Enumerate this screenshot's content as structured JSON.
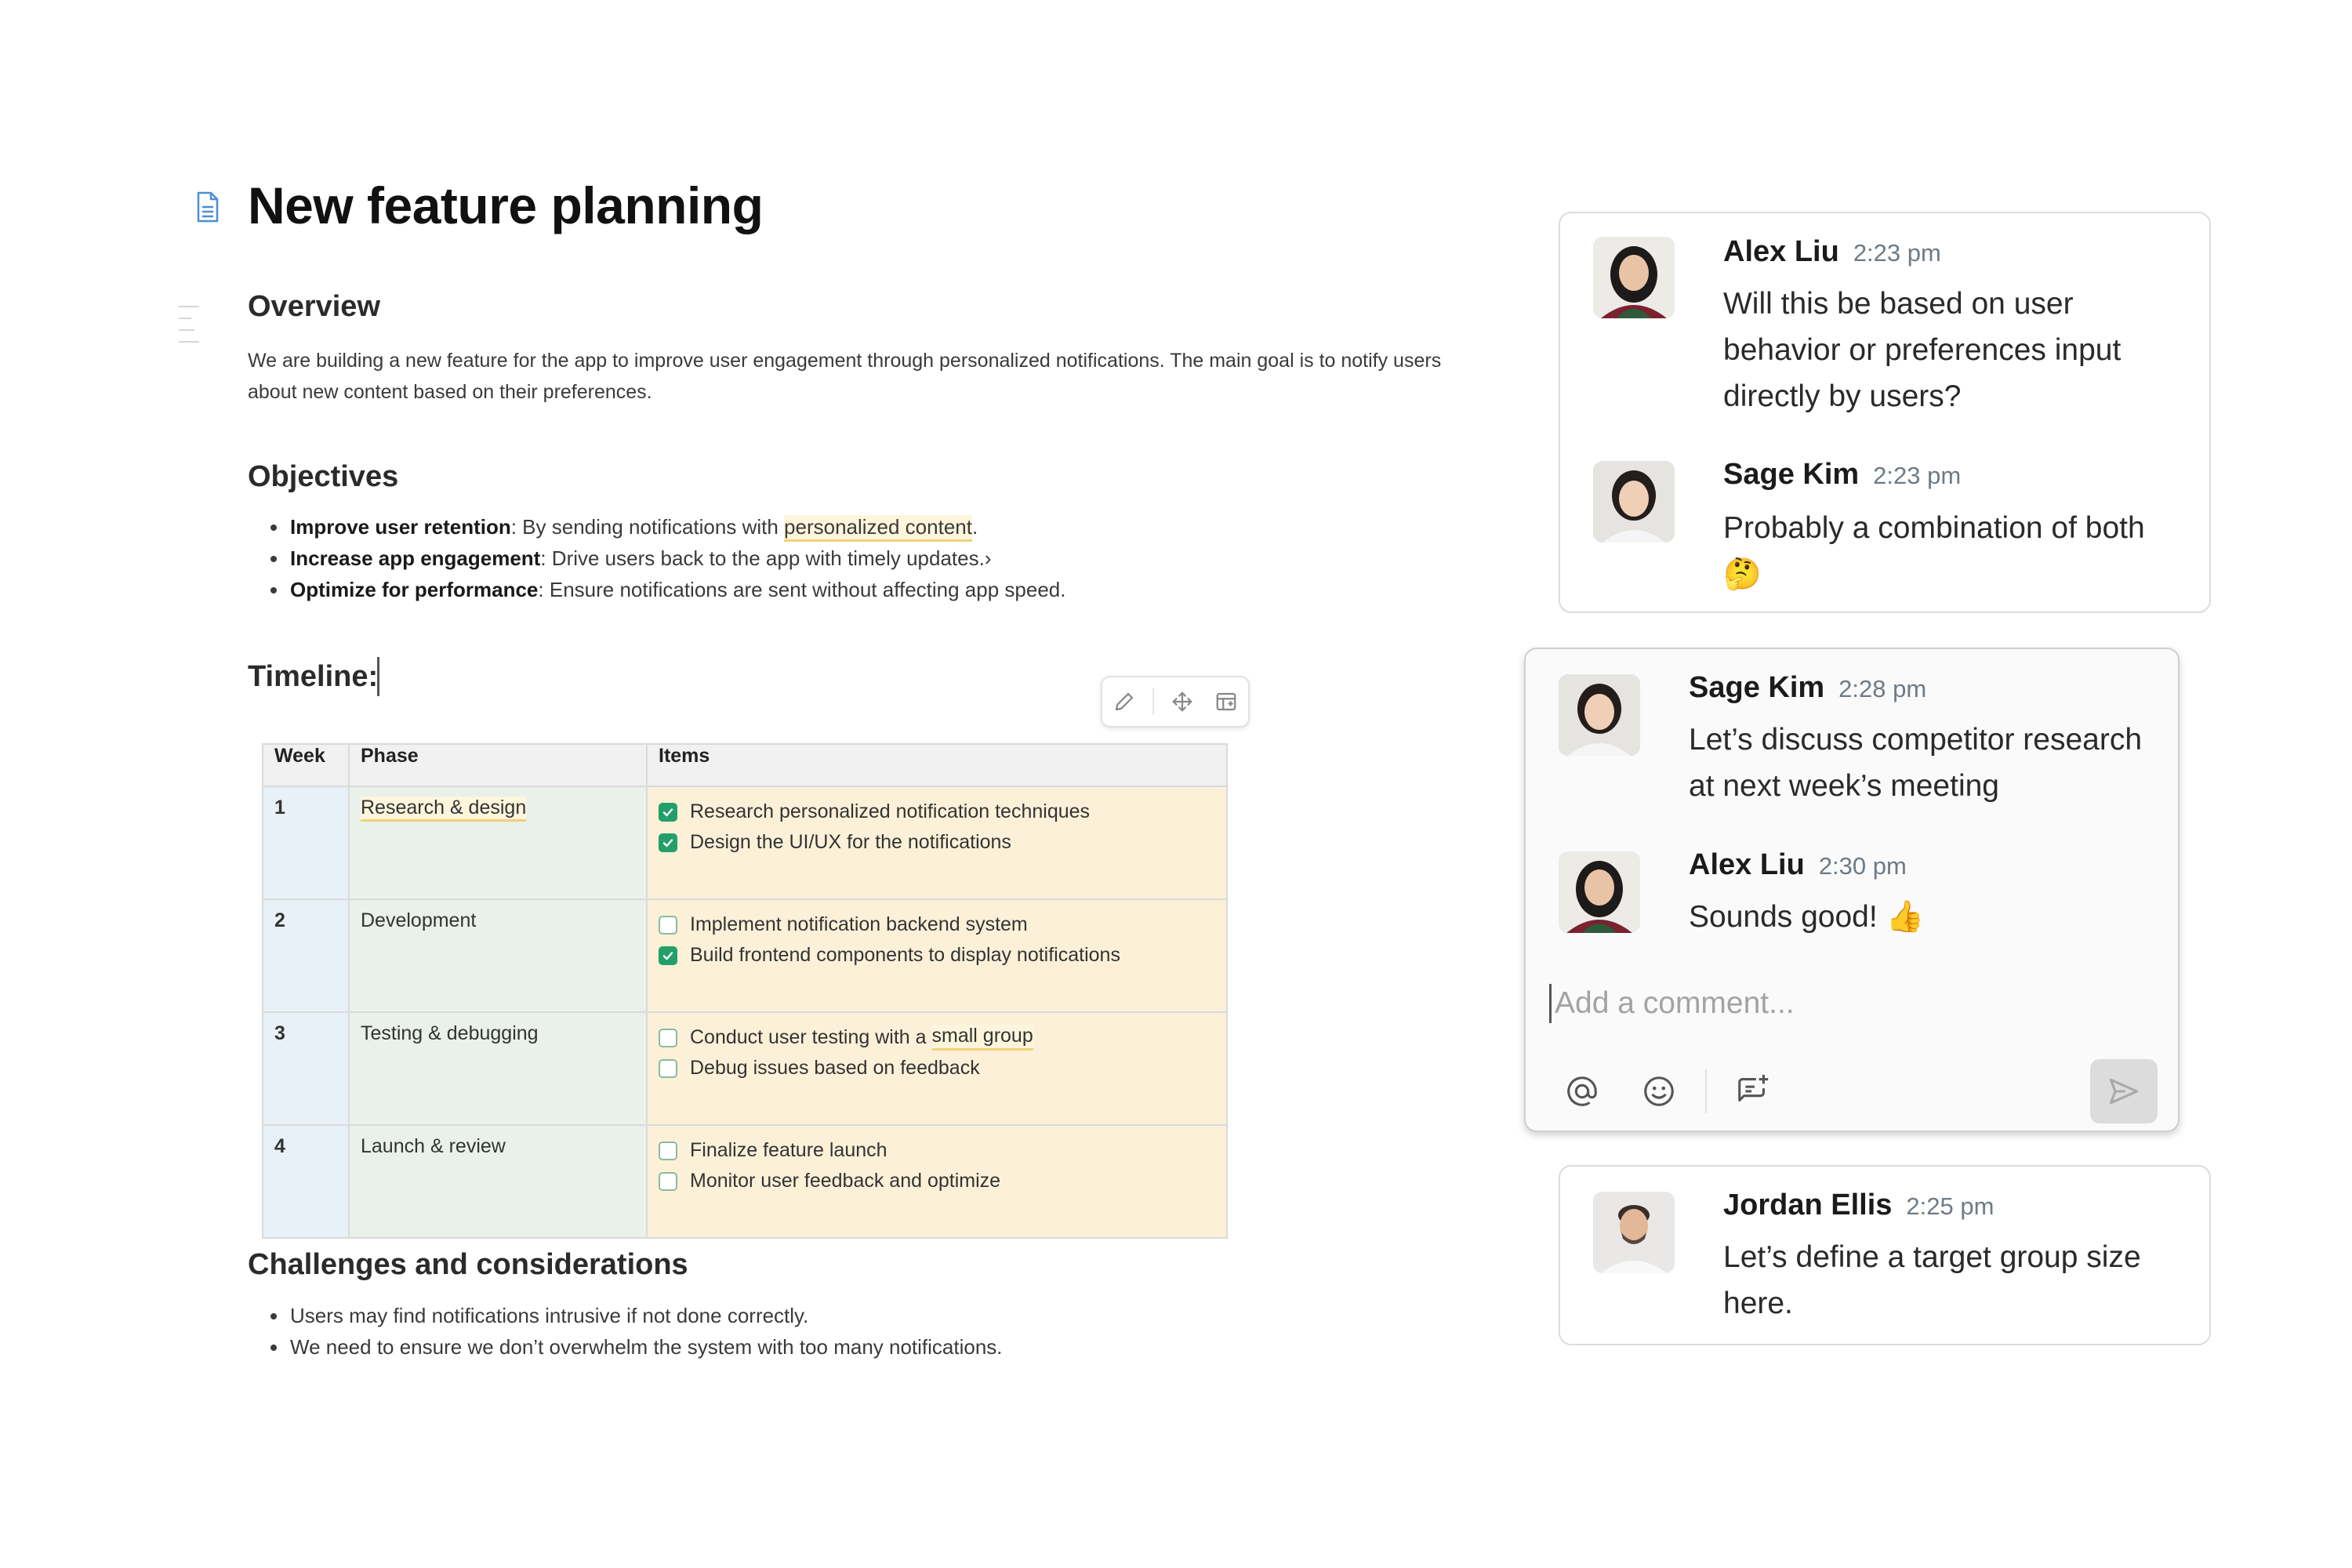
{
  "document": {
    "title": "New feature planning",
    "overview": {
      "heading": "Overview",
      "text": "We are building a new feature for the app to improve user engagement through personalized notifications. The main goal is to notify users about new content based on their preferences."
    },
    "objectives": {
      "heading": "Objectives",
      "items": [
        {
          "label": "Improve user retention",
          "text_before": ": By sending notifications with ",
          "highlight": "personalized content",
          "text_after": "."
        },
        {
          "label": "Increase app engagement",
          "text_before": ": Drive users back to the app with timely updates.›",
          "highlight": "",
          "text_after": ""
        },
        {
          "label": "Optimize for performance",
          "text_before": ": Ensure notifications are sent without affecting app speed.",
          "highlight": "",
          "text_after": ""
        }
      ]
    },
    "timeline": {
      "heading": "Timeline:",
      "columns": [
        "Week",
        "Phase",
        "Items"
      ],
      "rows": [
        {
          "week": "1",
          "phase": "Research & design",
          "phase_highlighted": true,
          "items": [
            {
              "checked": true,
              "text": "Research personalized notification techniques"
            },
            {
              "checked": true,
              "text": "Design the UI/UX for the notifications"
            }
          ]
        },
        {
          "week": "2",
          "phase": "Development",
          "phase_highlighted": false,
          "items": [
            {
              "checked": false,
              "text": "Implement notification backend system"
            },
            {
              "checked": true,
              "text": "Build frontend components to display notifications"
            }
          ]
        },
        {
          "week": "3",
          "phase": "Testing & debugging",
          "phase_highlighted": false,
          "items": [
            {
              "checked": false,
              "text": "Conduct user testing with a ",
              "highlight": "small group"
            },
            {
              "checked": false,
              "text": "Debug issues based on feedback"
            }
          ]
        },
        {
          "week": "4",
          "phase": "Launch & review",
          "phase_highlighted": false,
          "items": [
            {
              "checked": false,
              "text": "Finalize feature launch"
            },
            {
              "checked": false,
              "text": "Monitor user feedback and optimize"
            }
          ]
        }
      ],
      "toolbar_icons": [
        "pencil-icon",
        "move-icon",
        "table-settings-icon"
      ]
    },
    "challenges": {
      "heading": "Challenges and considerations",
      "items": [
        "Users may find notifications intrusive if not done correctly.",
        "We need to ensure we don’t overwhelm the system with too many notifications."
      ]
    }
  },
  "threads": [
    {
      "comments": [
        {
          "author": "Alex Liu",
          "time": "2:23 pm",
          "body": "Will this be based on user behavior or preferences input directly by users?",
          "emoji": ""
        },
        {
          "author": "Sage Kim",
          "time": "2:23 pm",
          "body": "Probably a combination of both",
          "emoji": "🤔"
        }
      ]
    },
    {
      "comments": [
        {
          "author": "Sage Kim",
          "time": "2:28 pm",
          "body": "Let’s discuss competitor research at next week’s meeting",
          "emoji": ""
        },
        {
          "author": "Alex Liu",
          "time": "2:30 pm",
          "body": "Sounds good!",
          "emoji": "👍"
        }
      ],
      "composer": {
        "placeholder": "Add a comment...",
        "icons": [
          "mention-icon",
          "emoji-icon",
          "add-attachment-icon",
          "send-icon"
        ]
      }
    },
    {
      "comments": [
        {
          "author": "Jordan Ellis",
          "time": "2:25 pm",
          "body": "Let’s define a target group size here.",
          "emoji": ""
        }
      ]
    }
  ],
  "colors": {
    "checkbox_checked": "#23a06a",
    "highlight_underline": "#f1d27a",
    "week_column_bg": "#e8f1f7",
    "phase_column_bg": "#eaf0ea",
    "items_column_bg": "#fcf1d8",
    "doc_icon": "#4a8fd6"
  }
}
